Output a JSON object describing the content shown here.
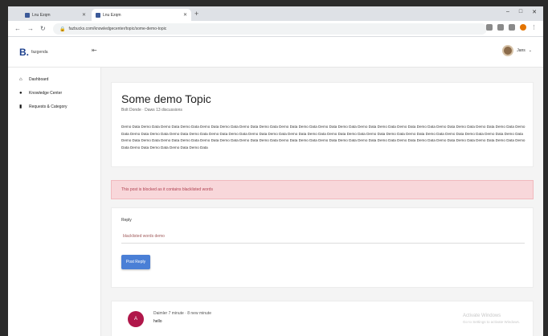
{
  "browser": {
    "tabs": [
      {
        "label": "Lnu Ezqm"
      },
      {
        "label": "Lnu Ezqm"
      }
    ],
    "new_tab": "+",
    "window_controls": [
      "–",
      "□",
      "✕"
    ],
    "url": "fazbucks.com/knowledgecenter/topic/some-demo-topic"
  },
  "header": {
    "logo_mark": "B.",
    "logo_text": "fazgenda",
    "user_name": "Jans"
  },
  "sidebar": {
    "items": [
      {
        "label": "Dashboard"
      },
      {
        "label": "Knowledge Center"
      },
      {
        "label": "Requests & Category"
      }
    ]
  },
  "topic": {
    "title": "Some demo Topic",
    "meta": "Bolt Donde  ·  Daws 13 discussions",
    "body": "Demo Data Demo Data Demo Data Demo Data Demo Data Demo Data Demo Data Demo Data Demo Data Demo Data Demo Data Demo Data Demo Data Demo Data Demo Data Demo Data Demo Data Demo Data Demo Data Demo Data Demo Data Demo Data Demo Data Demo Data Demo Data Demo Data Demo Data Demo Data Demo Data Demo Data Demo Data Demo Data Demo Data Demo Data Demo Data Demo Data Demo Data Demo Data Demo Data Demo Data Demo Data Demo Data Demo Data Demo Data Demo Data Demo Data Demo Data Demo Data Demo Data Demo Data Demo Data Demo Data Demo Data Demo Data Demo Data Demo Data Demo Data Demo Data Demo Data Demo Data Demo Data Demo Data Demo Data Demo Data Demo Data Demo Data"
  },
  "alert": {
    "text": "This post is blocked as it contains blacklisted words"
  },
  "reply": {
    "label": "Reply",
    "input_value": "blacklisted words demo",
    "button": "Post Reply"
  },
  "comment": {
    "avatar_initial": "A",
    "meta": "Daimler 7 minute · 8 new minute",
    "body": "hello",
    "watermark_line1": "Activate Windows",
    "watermark_line2": "Go to Settings to activate Windows."
  },
  "colors": {
    "accent": "#4a7fd6",
    "alert_bg": "#f8d7da",
    "alert_text": "#b04050",
    "avatar": "#b0174a",
    "logo": "#1a3e8c"
  }
}
